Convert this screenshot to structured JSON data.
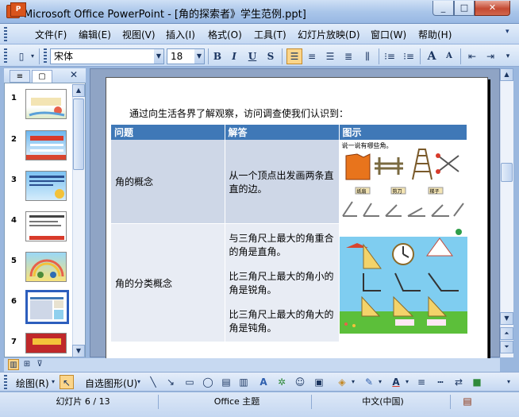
{
  "window": {
    "title": "Microsoft Office PowerPoint - [角的探索者》学生范例.ppt]",
    "min": "_",
    "max": "□",
    "close": "✕",
    "app_icon": "P"
  },
  "menu": {
    "items": [
      "文件(F)",
      "编辑(E)",
      "视图(V)",
      "插入(I)",
      "格式(O)",
      "工具(T)",
      "幻灯片放映(D)",
      "窗口(W)",
      "帮助(H)"
    ],
    "options_glyph": "▾"
  },
  "toolbar": {
    "font_name": "宋体",
    "font_size": "18",
    "bold": "B",
    "italic": "I",
    "underline": "U",
    "shadow": "S",
    "increase_font": "A",
    "decrease_font": "A"
  },
  "outline_pane": {
    "close": "✕",
    "tab_outline_glyph": "≡",
    "tab_slides_glyph": "▢",
    "slide_numbers": [
      "1",
      "2",
      "3",
      "4",
      "5",
      "6",
      "7"
    ],
    "selected": 6
  },
  "slide": {
    "intro": "通过向生活各界了解观察，访问调查使我们认识到：",
    "table": {
      "headers": [
        "问题",
        "解答",
        "图示"
      ],
      "rows": [
        {
          "question": "角的概念",
          "answer": "从一个顶点出发画两条直直的边。",
          "img_label": "说一说有哪些角。",
          "img_tags": [
            "纸扇",
            "剪刀",
            "梯子"
          ]
        },
        {
          "question": "角的分类概念",
          "answer_lines": [
            "与三角尺上最大的角重合的角是直角。",
            "比三角尺上最大的角小的角是锐角。",
            "比三角尺上最大的角大的角是钝角。"
          ]
        }
      ]
    }
  },
  "drawing_toolbar": {
    "draw": "绘图(R)",
    "autoshapes": "自选图形(U)"
  },
  "status": {
    "slide": "幻灯片 6 / 13",
    "theme": "Office 主题",
    "language": "中文(中国)"
  },
  "colors": {
    "accent": "#3f78b7",
    "selected_thumb": "#2d5ebd",
    "window_bg": "#9ab7de"
  }
}
